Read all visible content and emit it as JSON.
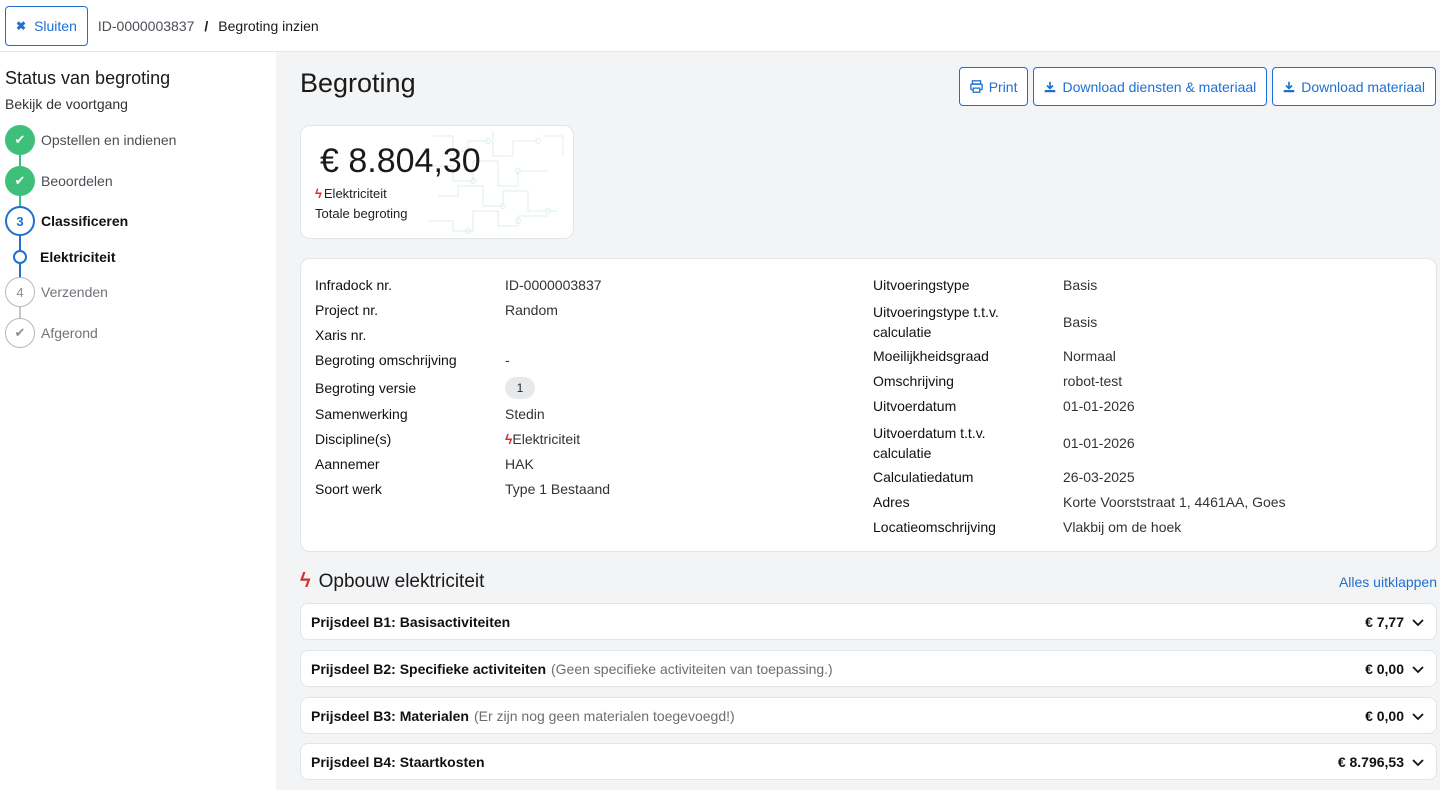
{
  "topbar": {
    "close_label": "Sluiten",
    "id": "ID-0000003837",
    "separator": "/",
    "current": "Begroting inzien"
  },
  "sidebar": {
    "title": "Status van begroting",
    "subtitle": "Bekijk de voortgang",
    "steps": [
      {
        "number": "",
        "label": "Opstellen en indienen",
        "state": "done"
      },
      {
        "number": "",
        "label": "Beoordelen",
        "state": "done"
      },
      {
        "number": "3",
        "label": "Classificeren",
        "state": "active"
      },
      {
        "number": "4",
        "label": "Verzenden",
        "state": "todo"
      },
      {
        "number": "",
        "label": "Afgerond",
        "state": "todo"
      }
    ],
    "substep": "Elektriciteit"
  },
  "main": {
    "title": "Begroting",
    "actions": {
      "print": "Print",
      "download_all": "Download diensten & materiaal",
      "download_material": "Download materiaal"
    },
    "total": {
      "amount": "€ 8.804,30",
      "discipline": "Elektriciteit",
      "label": "Totale begroting"
    },
    "info_left": [
      {
        "key": "Infradock nr.",
        "value": "ID-0000003837"
      },
      {
        "key": "Project nr.",
        "value": "Random"
      },
      {
        "key": "Xaris nr.",
        "value": ""
      },
      {
        "key": "Begroting omschrijving",
        "value": "-"
      },
      {
        "key": "Begroting versie",
        "value": "1"
      },
      {
        "key": "Samenwerking",
        "value": "Stedin"
      },
      {
        "key": "Discipline(s)",
        "value": "Elektriciteit"
      },
      {
        "key": "Aannemer",
        "value": "HAK"
      },
      {
        "key": "Soort werk",
        "value": "Type 1 Bestaand"
      }
    ],
    "info_right": [
      {
        "key": "Uitvoeringstype",
        "value": "Basis"
      },
      {
        "key": "Uitvoeringstype t.t.v.",
        "key2": "calculatie",
        "value": "Basis"
      },
      {
        "key": "Moeilijkheidsgraad",
        "value": "Normaal"
      },
      {
        "key": "Omschrijving",
        "value": "robot-test"
      },
      {
        "key": "Uitvoerdatum",
        "value": "01-01-2026"
      },
      {
        "key": "Uitvoerdatum t.t.v.",
        "key2": "calculatie",
        "value": "01-01-2026"
      },
      {
        "key": "Calculatiedatum",
        "value": "26-03-2025"
      },
      {
        "key": "Adres",
        "value": "Korte Voorststraat 1, 4461AA, Goes"
      },
      {
        "key": "Locatieomschrijving",
        "value": "Vlakbij om de hoek"
      }
    ],
    "section": {
      "title": "Opbouw elektriciteit",
      "expand_all": "Alles uitklappen"
    },
    "prijsdelen": [
      {
        "title": "Prijsdeel B1: Basisactiviteiten",
        "note": "",
        "amount": "€ 7,77"
      },
      {
        "title": "Prijsdeel B2: Specifieke activiteiten",
        "note": "(Geen specifieke activiteiten van toepassing.)",
        "amount": "€ 0,00"
      },
      {
        "title": "Prijsdeel B3: Materialen",
        "note": "(Er zijn nog geen materialen toegevoegd!)",
        "amount": "€ 0,00"
      },
      {
        "title": "Prijsdeel B4: Staartkosten",
        "note": "",
        "amount": "€ 8.796,53"
      }
    ]
  },
  "colors": {
    "accent": "#1f6fd1",
    "done": "#3fc07a",
    "bolt": "#d32f2f"
  }
}
